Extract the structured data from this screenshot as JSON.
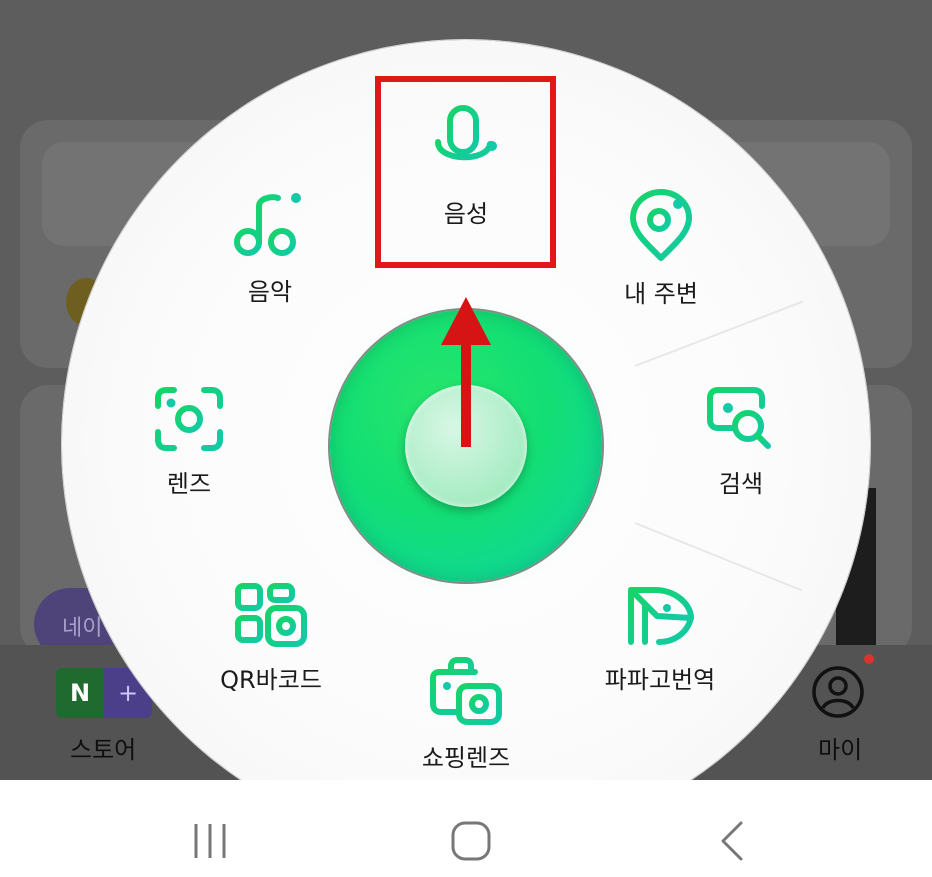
{
  "background_tabs": {
    "store_label": "스토어",
    "store_logo_n": "N",
    "store_logo_p": "+",
    "my_label": "마이",
    "bubble_text": "네이"
  },
  "wheel_menu": {
    "items": [
      {
        "id": "voice",
        "label": "음성",
        "icon": "microphone-icon"
      },
      {
        "id": "music",
        "label": "음악",
        "icon": "music-note-icon"
      },
      {
        "id": "nearby",
        "label": "내 주변",
        "icon": "location-pin-icon"
      },
      {
        "id": "lens",
        "label": "렌즈",
        "icon": "camera-lens-icon"
      },
      {
        "id": "search",
        "label": "검색",
        "icon": "search-screen-icon"
      },
      {
        "id": "qr",
        "label": "QR바코드",
        "icon": "qr-barcode-icon"
      },
      {
        "id": "papago",
        "label": "파파고번역",
        "icon": "papago-translate-icon"
      },
      {
        "id": "shopping",
        "label": "쇼핑렌즈",
        "icon": "shopping-bag-camera-icon"
      }
    ]
  },
  "annotation": {
    "highlight_color": "#e01818",
    "target": "voice"
  },
  "colors": {
    "accent_green": "#12de74",
    "accent_teal": "#0fd4a8",
    "icon_gradient_start": "#16d468",
    "icon_gradient_end": "#13c9a8"
  },
  "nav_bar": {
    "buttons": [
      {
        "id": "recent",
        "icon": "recent-apps-icon"
      },
      {
        "id": "home",
        "icon": "home-icon"
      },
      {
        "id": "back",
        "icon": "back-icon"
      }
    ]
  }
}
